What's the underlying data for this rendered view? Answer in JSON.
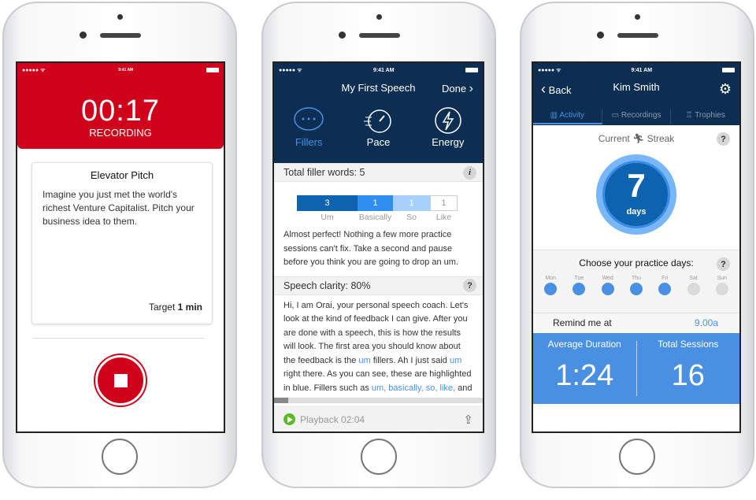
{
  "status": {
    "time": "9:41 AM"
  },
  "recording": {
    "timer": "00:17",
    "state": "RECORDING",
    "card_title": "Elevator Pitch",
    "card_body": "Imagine you just met the world's richest Venture Capitalist. Pitch your business idea to them.",
    "target_label": "Target",
    "target_value": "1 min"
  },
  "speech": {
    "title": "My First Speech",
    "done": "Done",
    "metrics": [
      {
        "label": "Fillers",
        "icon": "speech-bubble-icon",
        "active": true
      },
      {
        "label": "Pace",
        "icon": "stopwatch-icon"
      },
      {
        "label": "Energy",
        "icon": "lightning-icon"
      }
    ],
    "filler_header": "Total filler words: 5",
    "fillers": [
      {
        "word": "Um",
        "count": "3",
        "color": "#0d63ad"
      },
      {
        "word": "Basically",
        "count": "1",
        "color": "#2f8ff0"
      },
      {
        "word": "So",
        "count": "1",
        "color": "#a7d0fa"
      },
      {
        "word": "Like",
        "count": "1",
        "color": "#ffffff"
      }
    ],
    "feedback": "Almost perfect! Nothing a few more practice sessions can't fix. Take a second and pause before you think you are going to drop an um.",
    "clarity_header": "Speech clarity: 80%",
    "transcript": [
      {
        "t": "Hi, I am Orai, your personal speech coach. Let's look at the kind of feedback I can give. After you are done with a speech, this is how the results will look. The first area you should know about the feedback is the "
      },
      {
        "t": "um",
        "h": true
      },
      {
        "t": " fillers. Ah I just said "
      },
      {
        "t": "um",
        "h": true
      },
      {
        "t": " right there. As you can see, these are highlighted in blue. Fillers such as "
      },
      {
        "t": "um, basically, so, like,",
        "h": true
      },
      {
        "t": " and"
      }
    ],
    "playback": "Playback 02:04"
  },
  "profile": {
    "back": "Back",
    "name": "Kim Smith",
    "tabs": [
      "Activity",
      "Recordings",
      "Trophies"
    ],
    "streak_left": "Current",
    "streak_right": "Streak",
    "streak_value": "7",
    "streak_unit": "days",
    "practice_title": "Choose your practice days:",
    "days": [
      {
        "d": "Mon",
        "on": true
      },
      {
        "d": "Tue",
        "on": true
      },
      {
        "d": "Wed",
        "on": true
      },
      {
        "d": "Thu",
        "on": true
      },
      {
        "d": "Fri",
        "on": true
      },
      {
        "d": "Sat",
        "on": false
      },
      {
        "d": "Sun",
        "on": false
      }
    ],
    "remind_label": "Remind me at",
    "remind_value": "9.00a",
    "avg_label": "Average Duration",
    "avg_value": "1:24",
    "total_label": "Total Sessions",
    "total_value": "16"
  },
  "colors": {
    "red": "#d0021b",
    "navy": "#0b2e52",
    "blue": "#4a90e2",
    "play": "#5cb82a"
  }
}
